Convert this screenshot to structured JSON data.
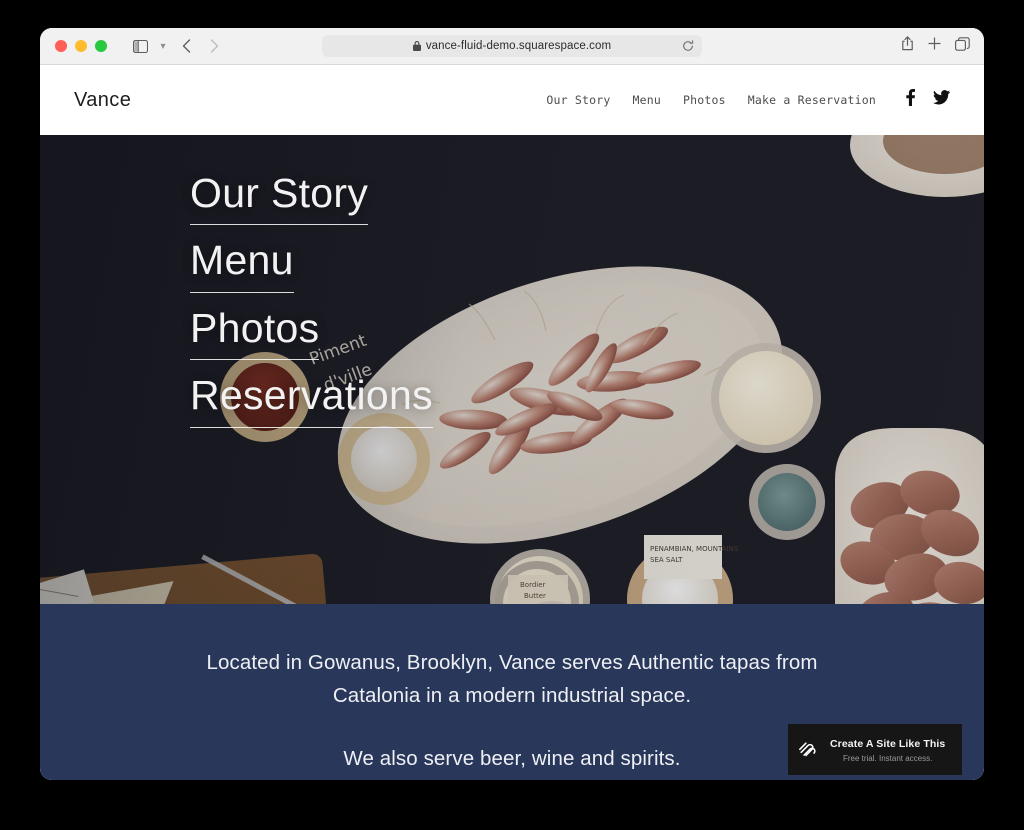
{
  "browser": {
    "url": "vance-fluid-demo.squarespace.com",
    "lock_icon": "lock-icon",
    "reload_icon": "reload-icon",
    "sidebar_icon": "sidebar-toggle-icon",
    "dropdown_icon": "chevron-down-icon",
    "back_icon": "back-arrow-icon",
    "forward_icon": "forward-arrow-icon",
    "share_icon": "share-icon",
    "new_tab_icon": "plus-icon",
    "tabs_icon": "tab-overview-icon",
    "traffic": {
      "close": "close-window-button",
      "minimize": "minimize-window-button",
      "zoom": "zoom-window-button"
    }
  },
  "site": {
    "logo": "Vance",
    "nav": [
      {
        "label": "Our Story"
      },
      {
        "label": "Menu"
      },
      {
        "label": "Photos"
      },
      {
        "label": "Make a Reservation"
      }
    ],
    "social": [
      {
        "name": "facebook-icon",
        "glyph": "f"
      },
      {
        "name": "twitter-icon",
        "glyph": "t"
      }
    ],
    "hero": {
      "links": [
        {
          "label": "Our Story"
        },
        {
          "label": "Menu"
        },
        {
          "label": "Photos"
        },
        {
          "label": "Reservations"
        }
      ],
      "image_description": "Overhead photo of tapas spread on dark table: white oval platter of fresh borlotti beans, bowls of whipped butter, flaky sea salt, piment d'Espelette, teal dip, cheese board with labeled wedges, bowl of nuts and a platter of sliced jamon"
    },
    "intro": {
      "paragraph_1": "Located in Gowanus, Brooklyn, Vance serves Authentic tapas from Catalonia in a modern industrial space.",
      "paragraph_2": "We also serve beer, wine and spirits."
    },
    "promo": {
      "title": "Create A Site Like This",
      "subtitle": "Free trial. Instant access.",
      "logo_icon": "squarespace-logo-icon"
    }
  },
  "colors": {
    "blue_section": "#28375a",
    "promo_bg": "#161616",
    "chrome_bg": "#f2f1f1",
    "page_bg": "#000000"
  }
}
